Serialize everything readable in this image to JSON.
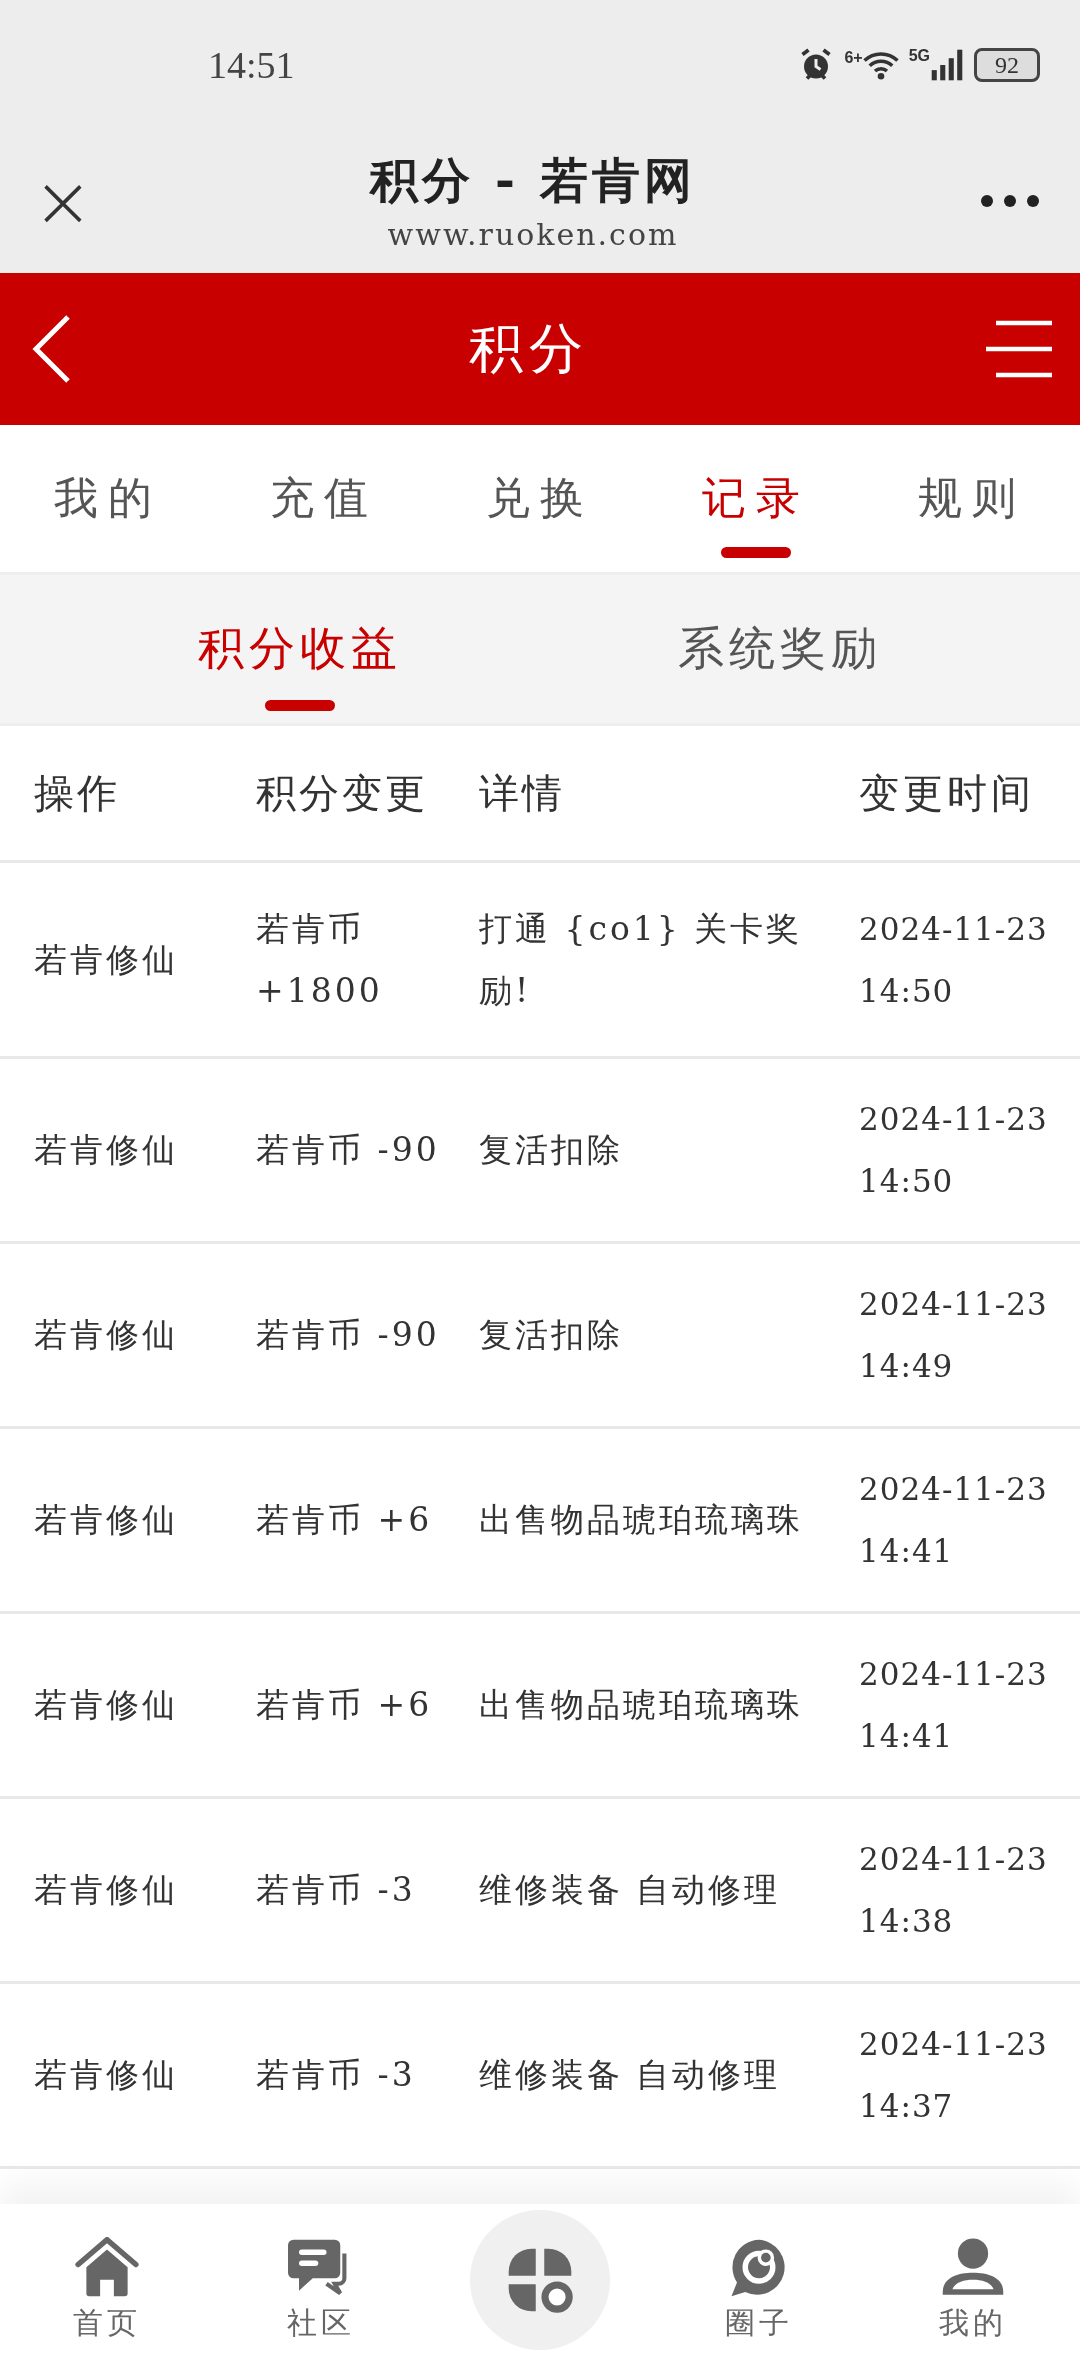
{
  "status_bar": {
    "time": "14:51",
    "network": "5G",
    "wifi_badge": "6+",
    "battery": "92"
  },
  "browser": {
    "title": "积分 - 若肯网",
    "url": "www.ruoken.com",
    "close": "×"
  },
  "header": {
    "title": "积分"
  },
  "tabs": [
    {
      "label": "我的",
      "selected": false
    },
    {
      "label": "充值",
      "selected": false
    },
    {
      "label": "兑换",
      "selected": false
    },
    {
      "label": "记录",
      "selected": true
    },
    {
      "label": "规则",
      "selected": false
    }
  ],
  "subtabs": [
    {
      "label": "积分收益",
      "selected": true
    },
    {
      "label": "系统奖励",
      "selected": false
    }
  ],
  "table": {
    "columns": [
      "操作",
      "积分变更",
      "详情",
      "变更时间"
    ],
    "rows": [
      {
        "cells": [
          "若肯修仙",
          "若肯币 +1800",
          "打通 {co1} 关卡奖励!",
          "2024-11-23 14:50"
        ]
      },
      {
        "cells": [
          "若肯修仙",
          "若肯币 -90",
          "复活扣除",
          "2024-11-23 14:50"
        ]
      },
      {
        "cells": [
          "若肯修仙",
          "若肯币 -90",
          "复活扣除",
          "2024-11-23 14:49"
        ]
      },
      {
        "cells": [
          "若肯修仙",
          "若肯币 +6",
          "出售物品琥珀琉璃珠",
          "2024-11-23 14:41"
        ]
      },
      {
        "cells": [
          "若肯修仙",
          "若肯币 +6",
          "出售物品琥珀琉璃珠",
          "2024-11-23 14:41"
        ]
      },
      {
        "cells": [
          "若肯修仙",
          "若肯币 -3",
          "维修装备 自动修理",
          "2024-11-23 14:38"
        ]
      },
      {
        "cells": [
          "若肯修仙",
          "若肯币 -3",
          "维修装备 自动修理",
          "2024-11-23 14:37"
        ]
      }
    ]
  },
  "bottom_nav": [
    {
      "label": "首页",
      "kind": "home"
    },
    {
      "label": "社区",
      "kind": "chat"
    },
    {
      "kind": "center"
    },
    {
      "label": "圈子",
      "kind": "circle"
    },
    {
      "label": "我的",
      "kind": "user"
    }
  ]
}
